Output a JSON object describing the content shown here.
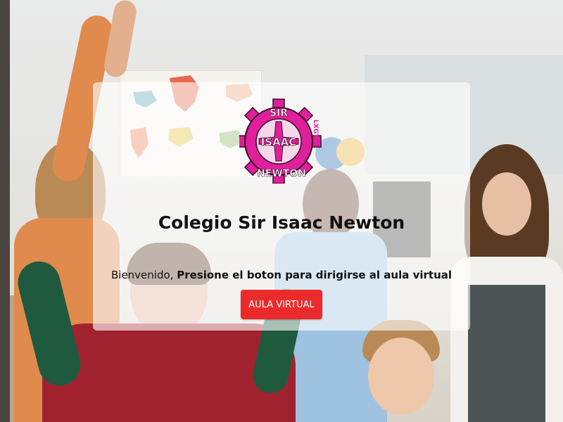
{
  "school": {
    "title": "Colegio Sir Isaac Newton",
    "logo_text": {
      "top": "SIR",
      "middle": "ISAAC",
      "bottom": "NEWTON",
      "side": "LXGT"
    }
  },
  "welcome": {
    "greeting": "Bienvenido,",
    "instruction": "Presione el boton para dirigirse al aula virtual"
  },
  "cta": {
    "label": "AULA VIRTUAL"
  },
  "colors": {
    "brand": "#e01f9a",
    "button": "#eb2b2b",
    "card_bg": "rgba(255,255,255,0.62)"
  }
}
